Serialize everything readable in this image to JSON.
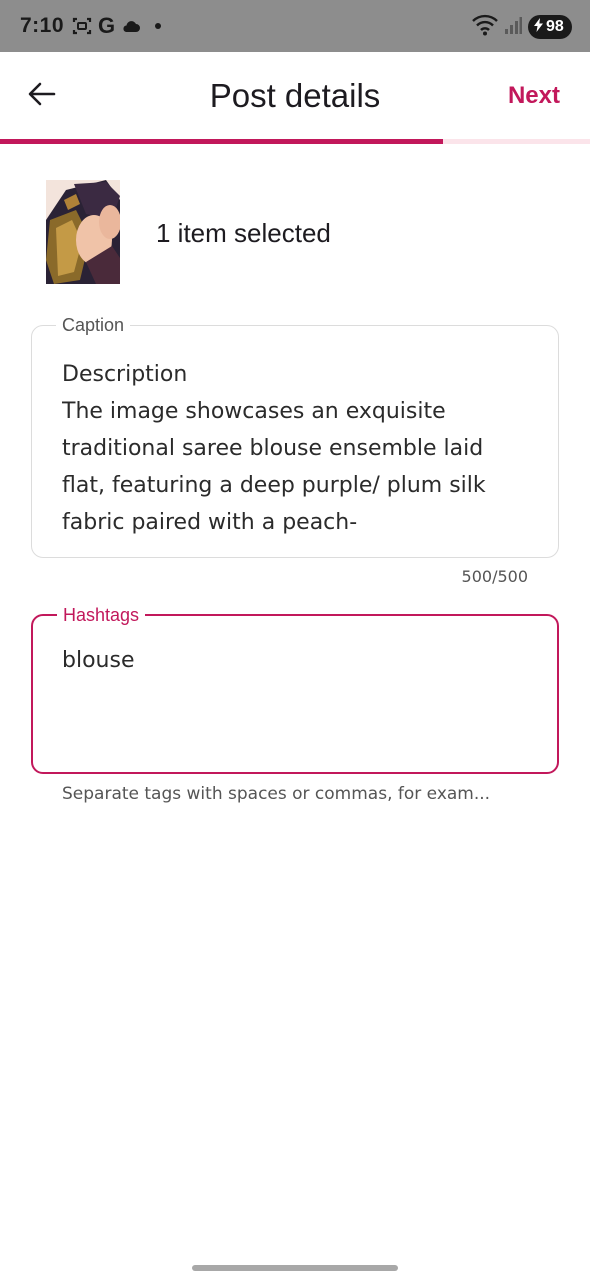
{
  "status_bar": {
    "time": "7:10",
    "g_letter": "G",
    "battery_level": "98",
    "icons": [
      "screenshot-icon",
      "google-icon",
      "cloud-icon",
      "notification-dot-icon",
      "wifi-icon",
      "signal-icon",
      "battery-charging-icon"
    ]
  },
  "header": {
    "title": "Post details",
    "next_label": "Next",
    "back_icon": "arrow-left-icon"
  },
  "progress": {
    "fraction": 0.75
  },
  "selection": {
    "count_text": "1 item selected"
  },
  "caption": {
    "label": "Caption",
    "value": "Description\nThe image showcases an exquisite traditional saree blouse ensemble laid flat, featuring a deep purple/ plum silk fabric paired with a peach-",
    "counter": "500/500"
  },
  "hashtags": {
    "label": "Hashtags",
    "value": "blouse",
    "helper": "Separate tags with spaces or commas, for exam..."
  },
  "colors": {
    "accent": "#c2185b",
    "status_bar_bg": "#8d8d8d",
    "progress_track": "#fbe4ea"
  }
}
